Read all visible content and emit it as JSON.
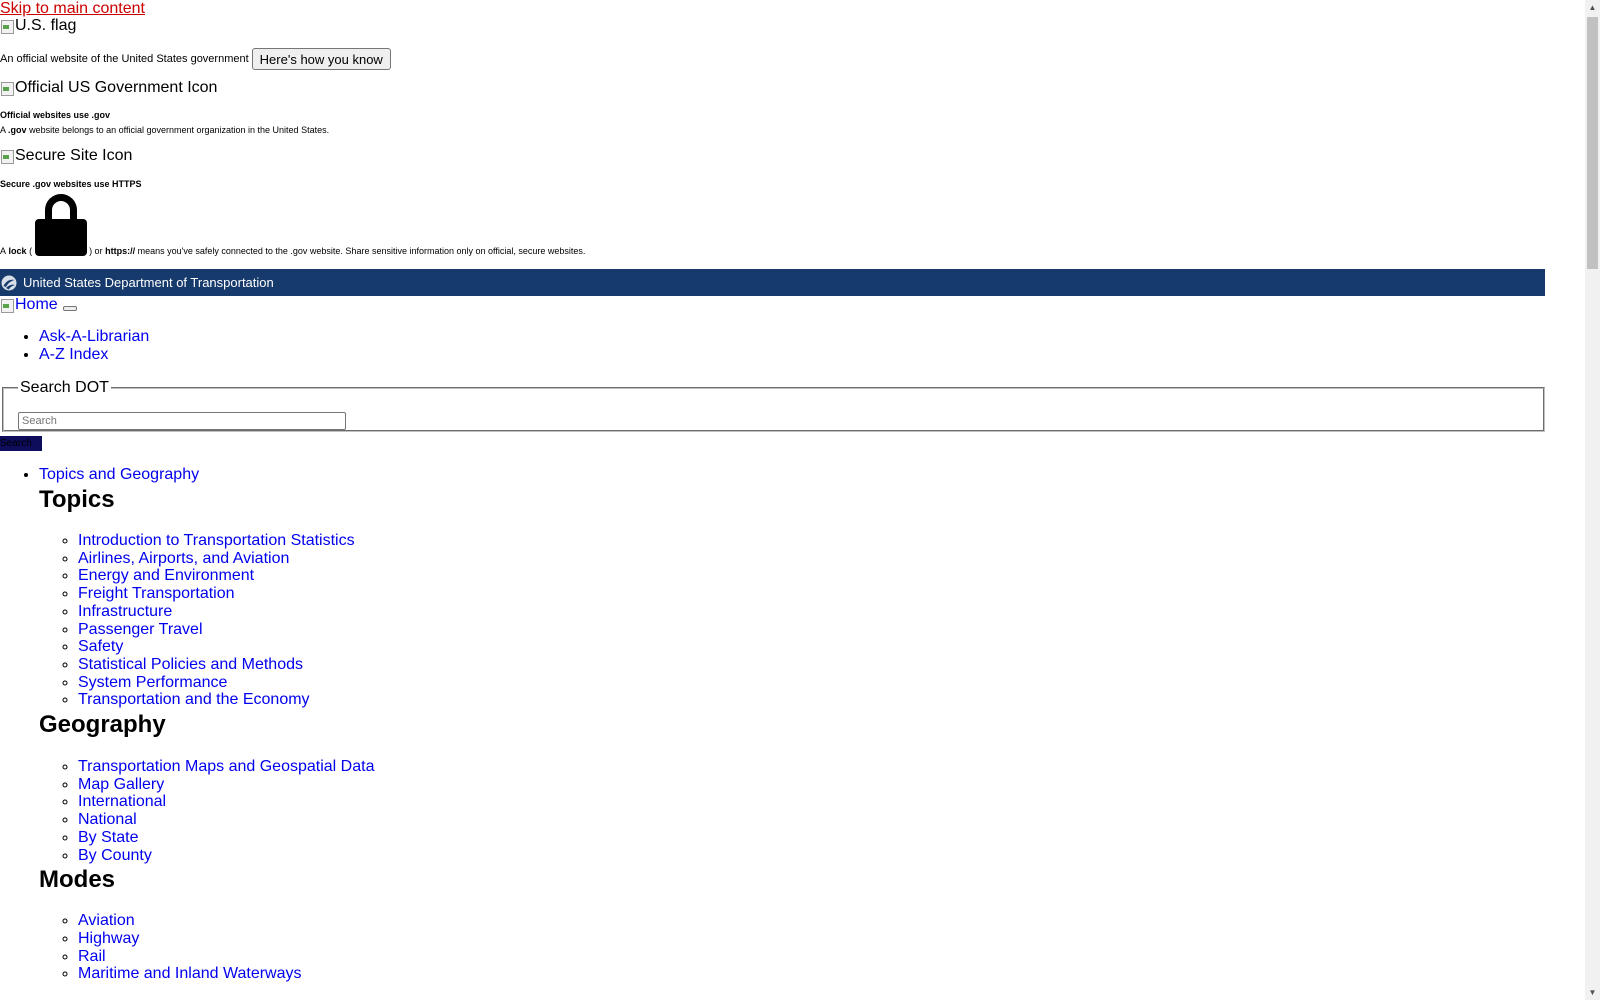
{
  "skip_link": "Skip to main content",
  "banner": {
    "flag_alt": "U.S. flag",
    "official_text": "An official website of the United States government",
    "how_button": "Here's how you know",
    "gov_icon_alt": "Official US Government Icon",
    "gov_title": "Official websites use .gov",
    "gov_desc_prefix": "A",
    "gov_desc_bold": ".gov",
    "gov_desc_suffix": "website belongs to an official government organization in the United States.",
    "secure_icon_alt": "Secure Site Icon",
    "secure_title": "Secure .gov websites use HTTPS",
    "secure_desc_a": "A",
    "secure_desc_lock": "lock",
    "secure_desc_paren_open": "(",
    "secure_desc_paren_close": ") or",
    "secure_desc_https": "https://",
    "secure_desc_rest": "means you've safely connected to the .gov website. Share sensitive information only on official, secure websites."
  },
  "dot_bar": {
    "text": "United States Department of Transportation",
    "color": "#163a6b"
  },
  "header": {
    "home_alt": "Home"
  },
  "utility_links": [
    "Ask-A-Librarian",
    "A-Z Index"
  ],
  "search": {
    "legend": "Search DOT",
    "placeholder": "Search",
    "button": "Search"
  },
  "nav": {
    "top_link": "Topics and Geography",
    "topics_heading": "Topics",
    "topics": [
      "Introduction to Transportation Statistics",
      "Airlines, Airports, and Aviation",
      "Energy and Environment",
      "Freight Transportation",
      "Infrastructure",
      "Passenger Travel",
      "Safety",
      "Statistical Policies and Methods",
      "System Performance",
      "Transportation and the Economy"
    ],
    "geography_heading": "Geography",
    "geography": [
      "Transportation Maps and Geospatial Data",
      "Map Gallery",
      "International",
      "National",
      "By State",
      "By County"
    ],
    "modes_heading": "Modes",
    "modes": [
      "Aviation",
      "Highway",
      "Rail",
      "Maritime and Inland Waterways"
    ]
  }
}
